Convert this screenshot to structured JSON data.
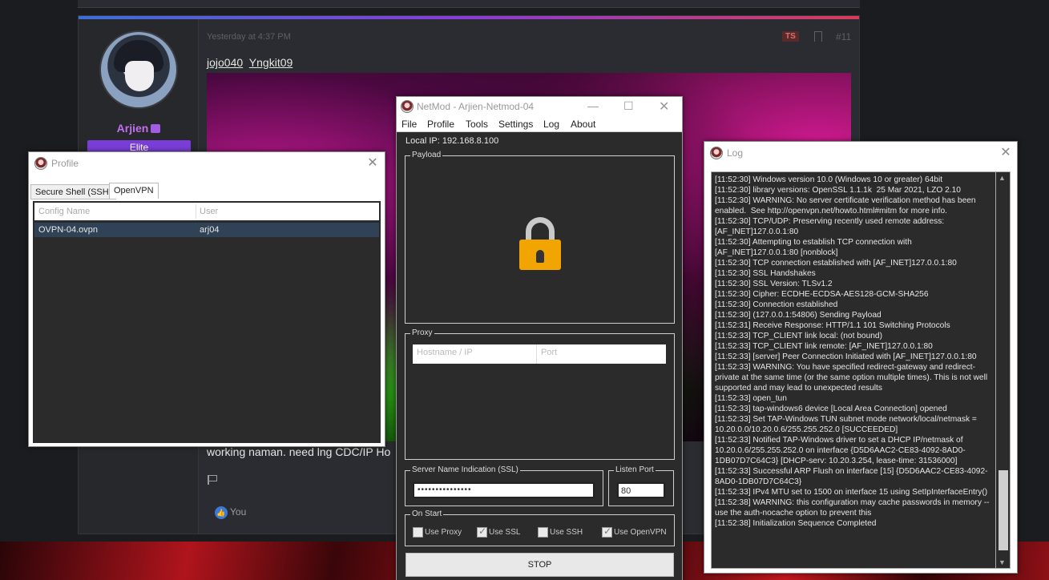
{
  "forum": {
    "post_time": "Yesterday at 4:37 PM",
    "ts_badge": "TS",
    "post_number": "#11",
    "username": "Arjien",
    "user_title": "Elite",
    "mentions": [
      "jojo040",
      "Yngkit09"
    ],
    "post_text": "working naman. need lng CDC/IP Ho",
    "likes_label": "You",
    "accent_color": "#c06ff0"
  },
  "profile_window": {
    "title": "Profile",
    "tabs": [
      {
        "label": "Secure Shell (SSH)",
        "active": false
      },
      {
        "label": "OpenVPN",
        "active": true
      }
    ],
    "columns": [
      "Config Name",
      "User"
    ],
    "rows": [
      {
        "config": "OVPN-04.ovpn",
        "user": "arj04"
      }
    ]
  },
  "netmod_window": {
    "title": "NetMod - Arjien-Netmod-04",
    "menu": [
      "File",
      "Profile",
      "Tools",
      "Settings",
      "Log",
      "About"
    ],
    "local_ip": "Local IP: 192.168.8.100",
    "payload_label": "Payload",
    "proxy_label": "Proxy",
    "proxy_host_placeholder": "Hostname / IP",
    "proxy_port_placeholder": "Port",
    "sni_label": "Server Name Indication (SSL)",
    "sni_value": "•••••••••••••••",
    "listen_port_label": "Listen Port",
    "listen_port_value": "80",
    "on_start_label": "On Start",
    "options": [
      {
        "label": "Use Proxy",
        "checked": false
      },
      {
        "label": "Use SSL",
        "checked": true
      },
      {
        "label": "Use SSH",
        "checked": false
      },
      {
        "label": "Use OpenVPN",
        "checked": true
      }
    ],
    "stop_label": "STOP",
    "lock_icon": "lock-icon"
  },
  "log_window": {
    "title": "Log",
    "text": "[11:52:30] Windows version 10.0 (Windows 10 or greater) 64bit\n[11:52:30] library versions: OpenSSL 1.1.1k  25 Mar 2021, LZO 2.10\n[11:52:30] WARNING: No server certificate verification method has been enabled.  See http://openvpn.net/howto.html#mitm for more info.\n[11:52:30] TCP/UDP: Preserving recently used remote address: [AF_INET]127.0.0.1:80\n[11:52:30] Attempting to establish TCP connection with [AF_INET]127.0.0.1:80 [nonblock]\n[11:52:30] TCP connection established with [AF_INET]127.0.0.1:80\n[11:52:30] SSL Handshakes\n[11:52:30] SSL Version: TLSv1.2\n[11:52:30] Cipher: ECDHE-ECDSA-AES128-GCM-SHA256\n[11:52:30] Connection established\n[11:52:30] (127.0.0.1:54806) Sending Payload\n[11:52:31] Receive Response: HTTP/1.1 101 Switching Protocols\n[11:52:33] TCP_CLIENT link local: (not bound)\n[11:52:33] TCP_CLIENT link remote: [AF_INET]127.0.0.1:80\n[11:52:33] [server] Peer Connection Initiated with [AF_INET]127.0.0.1:80\n[11:52:33] WARNING: You have specified redirect-gateway and redirect-private at the same time (or the same option multiple times). This is not well supported and may lead to unexpected results\n[11:52:33] open_tun\n[11:52:33] tap-windows6 device [Local Area Connection] opened\n[11:52:33] Set TAP-Windows TUN subnet mode network/local/netmask = 10.20.0.0/10.20.0.6/255.255.252.0 [SUCCEEDED]\n[11:52:33] Notified TAP-Windows driver to set a DHCP IP/netmask of 10.20.0.6/255.255.252.0 on interface {D5D6AAC2-CE83-4092-8AD0-1DB07D7C64C3} [DHCP-serv: 10.20.3.254, lease-time: 31536000]\n[11:52:33] Successful ARP Flush on interface [15] {D5D6AAC2-CE83-4092-8AD0-1DB07D7C64C3}\n[11:52:33] IPv4 MTU set to 1500 on interface 15 using SetIpInterfaceEntry()\n[11:52:38] WARNING: this configuration may cache passwords in memory -- use the auth-nocache option to prevent this\n[11:52:38] Initialization Sequence Completed"
  }
}
